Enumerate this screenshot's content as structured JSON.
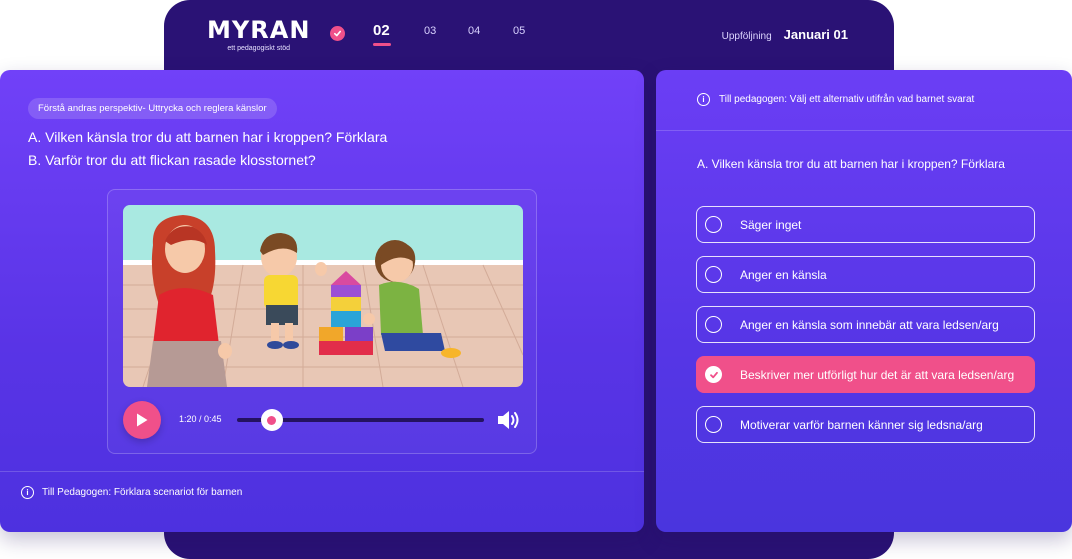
{
  "header": {
    "logo_text": "MYRAN",
    "logo_sub": "ett pedagogiskt stöd",
    "steps": [
      "02",
      "03",
      "04",
      "05"
    ],
    "active_step": "02",
    "followup_label": "Uppföljning",
    "followup_date": "Januari 01"
  },
  "left": {
    "topic_chip": "Förstå andras perspektiv- Uttrycka och reglera känslor",
    "question_a": "A. Vilken känsla tror du att barnen har i kroppen? Förklara",
    "question_b": "B. Varför tror du att flickan rasade klosstornet?",
    "video": {
      "time": "1:20 / 0:45",
      "progress": 0.14
    },
    "hint": "Till Pedagogen: Förklara scenariot för barnen"
  },
  "right": {
    "hint": "Till pedagogen: Välj ett alternativ utifrån vad barnet svarat",
    "question": "A. Vilken känsla tror du att barnen har i kroppen? Förklara",
    "options": [
      "Säger inget",
      "Anger en känsla",
      "Anger en känsla som innebär att vara ledsen/arg",
      "Beskriver mer utförligt hur det är att vara ledsen/arg",
      "Motiverar varför barnen känner sig ledsna/arg"
    ],
    "selected_option": "Beskriver mer utförligt hur det är att vara ledsen/arg"
  },
  "colors": {
    "accent": "#f0508a",
    "header_bg": "#2a1275",
    "panel_top": "#7141f8",
    "panel_bottom": "#4d31df"
  },
  "icons": [
    "check-icon",
    "play-icon",
    "volume-icon",
    "info-icon",
    "radio-icon"
  ]
}
